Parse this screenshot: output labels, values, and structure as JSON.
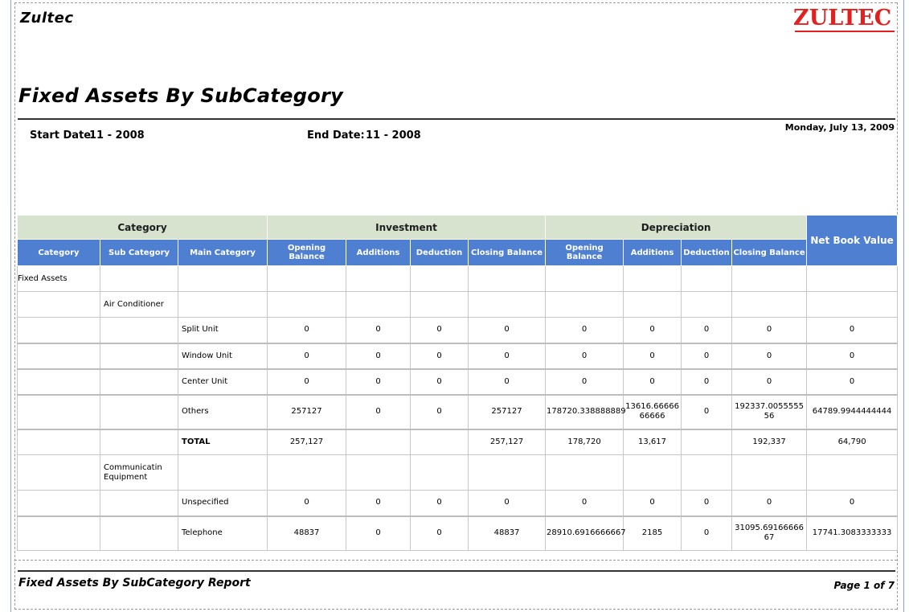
{
  "report": {
    "company": "Zultec",
    "logo_text": "ZULTEC",
    "title": "Fixed Assets By SubCategory",
    "start_date_label": "Start Date:",
    "start_date_value": "11 - 2008",
    "end_date_label": "End Date:",
    "end_date_value": "11 - 2008",
    "print_date": "Monday, July 13, 2009",
    "footer_title": "Fixed Assets By SubCategory Report",
    "page_info": "Page 1 of 7"
  },
  "table": {
    "groups": {
      "category": "Category",
      "investment": "Investment",
      "depreciation": "Depreciation",
      "net_book_value": "Net Book Value"
    },
    "columns": [
      "Category",
      "Sub Category",
      "Main Category",
      "Opening Balance",
      "Additions",
      "Deduction",
      "Closing Balance",
      "Opening Balance",
      "Additions",
      "Deduction",
      "Closing Balance"
    ],
    "rows": [
      [
        "Fixed Assets",
        "",
        "",
        "",
        "",
        "",
        "",
        "",
        "",
        "",
        "",
        ""
      ],
      [
        "",
        "Air Conditioner",
        "",
        "",
        "",
        "",
        "",
        "",
        "",
        "",
        "",
        ""
      ],
      [
        "",
        "",
        "Split Unit",
        "0",
        "0",
        "0",
        "0",
        "0",
        "0",
        "0",
        "0",
        "0"
      ],
      [
        "",
        "",
        "Window Unit",
        "0",
        "0",
        "0",
        "0",
        "0",
        "0",
        "0",
        "0",
        "0"
      ],
      [
        "",
        "",
        "Center Unit",
        "0",
        "0",
        "0",
        "0",
        "0",
        "0",
        "0",
        "0",
        "0"
      ],
      [
        "",
        "",
        "Others",
        "257127",
        "0",
        "0",
        "257127",
        "178720.338888889",
        "13616.66666\n66666",
        "0",
        "192337.0055555\n56",
        "64789.9944444444"
      ],
      [
        "",
        "",
        "TOTAL",
        "257,127",
        "",
        "",
        "257,127",
        "178,720",
        "13,617",
        "",
        "192,337",
        "64,790"
      ],
      [
        "",
        "Communicatin\nEquipment",
        "",
        "",
        "",
        "",
        "",
        "",
        "",
        "",
        "",
        ""
      ],
      [
        "",
        "",
        "Unspecified",
        "0",
        "0",
        "0",
        "0",
        "0",
        "0",
        "0",
        "0",
        "0"
      ],
      [
        "",
        "",
        "Telephone",
        "48837",
        "0",
        "0",
        "48837",
        "28910.6916666667",
        "2185",
        "0",
        "31095.69166666\n67",
        "17741.3083333333"
      ]
    ]
  }
}
